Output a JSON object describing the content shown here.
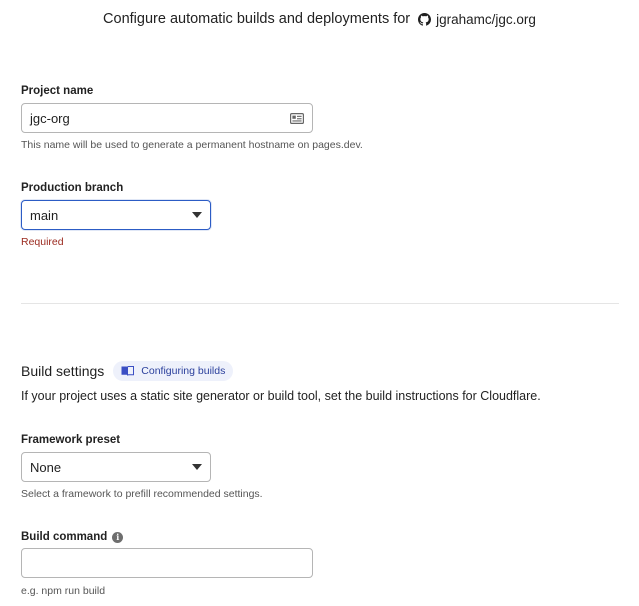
{
  "header": {
    "title": "Configure automatic builds and deployments for",
    "repo": "jgrahamc/jgc.org",
    "repo_icon": "github-icon"
  },
  "project_name": {
    "label": "Project name",
    "value": "jgc-org",
    "help": "This name will be used to generate a permanent hostname on pages.dev.",
    "icon": "id-card-icon"
  },
  "production_branch": {
    "label": "Production branch",
    "value": "main",
    "error": "Required"
  },
  "build_settings": {
    "title": "Build settings",
    "doc_link": "Configuring builds",
    "description": "If your project uses a static site generator or build tool, set the build instructions for Cloudflare."
  },
  "framework_preset": {
    "label": "Framework preset",
    "value": "None",
    "help": "Select a framework to prefill recommended settings."
  },
  "build_command": {
    "label": "Build command",
    "value": "",
    "help": "e.g. npm run build"
  },
  "colors": {
    "focus_border": "#2c5cc5",
    "error_text": "#9b2a1f",
    "pill_bg": "#eef1fb",
    "pill_text": "#2a3f9c"
  }
}
